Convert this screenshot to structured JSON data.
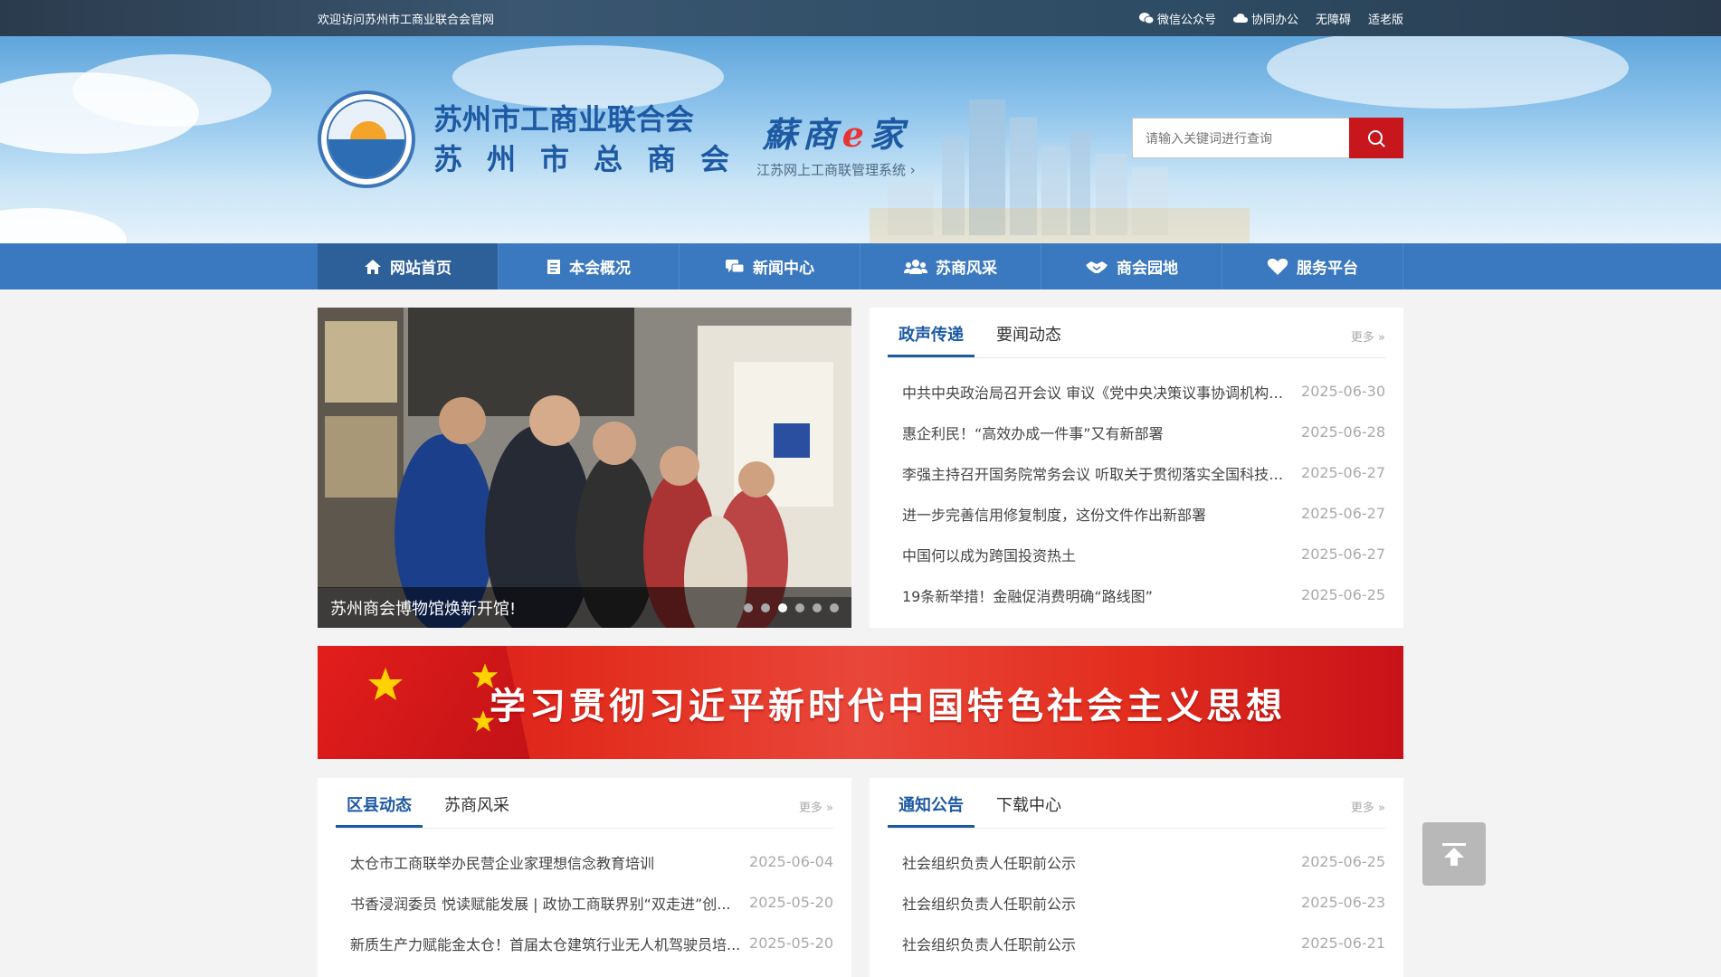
{
  "topbar": {
    "welcome": "欢迎访问苏州市工商业联合会官网",
    "links": [
      {
        "label": "微信公众号",
        "icon": "wechat-icon"
      },
      {
        "label": "协同办公",
        "icon": "cloud-icon"
      },
      {
        "label": "无障碍"
      },
      {
        "label": "适老版"
      }
    ]
  },
  "header": {
    "org_name_1": "苏州市工商业联合会",
    "org_name_2": "苏州市总商会",
    "esys_brand_1": "蘇商",
    "esys_brand_e": "e",
    "esys_brand_2": "家",
    "esys_sub": "江苏网上工商联管理系统",
    "search_placeholder": "请输入关键词进行查询"
  },
  "nav": {
    "items": [
      {
        "label": "网站首页",
        "icon": "home-icon",
        "active": true
      },
      {
        "label": "本会概况",
        "icon": "document-icon"
      },
      {
        "label": "新闻中心",
        "icon": "chat-icon"
      },
      {
        "label": "苏商风采",
        "icon": "people-icon"
      },
      {
        "label": "商会园地",
        "icon": "handshake-icon"
      },
      {
        "label": "服务平台",
        "icon": "heart-icon"
      }
    ]
  },
  "slider": {
    "caption": "苏州商会博物馆焕新开馆!",
    "dots": 6,
    "active_dot": 3
  },
  "news1": {
    "tabs": [
      "政声传递",
      "要闻动态"
    ],
    "more": "更多 »",
    "items": [
      {
        "title": "中共中央政治局召开会议 审议《党中央决策议事协调机构工...",
        "date": "2025-06-30"
      },
      {
        "title": "惠企利民！“高效办成一件事”又有新部署",
        "date": "2025-06-28"
      },
      {
        "title": "李强主持召开国务院常务会议 听取关于贯彻落实全国科技大...",
        "date": "2025-06-27"
      },
      {
        "title": "进一步完善信用修复制度，这份文件作出新部署",
        "date": "2025-06-27"
      },
      {
        "title": "中国何以成为跨国投资热土",
        "date": "2025-06-27"
      },
      {
        "title": "19条新举措！金融促消费明确“路线图”",
        "date": "2025-06-25"
      }
    ]
  },
  "banner": {
    "title": "学习贯彻习近平新时代中国特色社会主义思想"
  },
  "news2": {
    "tabs": [
      "区县动态",
      "苏商风采"
    ],
    "more": "更多 »",
    "items": [
      {
        "title": "太仓市工商联举办民营企业家理想信念教育培训",
        "date": "2025-06-04"
      },
      {
        "title": "书香浸润委员 悦读赋能发展 | 政协工商联界别“双走进”创...",
        "date": "2025-05-20"
      },
      {
        "title": "新质生产力赋能金太仓！首届太仓建筑行业无人机驾驶员培...",
        "date": "2025-05-20"
      }
    ]
  },
  "news3": {
    "tabs": [
      "通知公告",
      "下载中心"
    ],
    "more": "更多 »",
    "items": [
      {
        "title": "社会组织负责人任职前公示",
        "date": "2025-06-25"
      },
      {
        "title": "社会组织负责人任职前公示",
        "date": "2025-06-23"
      },
      {
        "title": "社会组织负责人任职前公示",
        "date": "2025-06-21"
      }
    ]
  },
  "colors": {
    "primary": "#1e5aa3",
    "nav": "#3a78bf",
    "nav_active": "#2d5f99",
    "search_button": "#c8161d",
    "banner": "#d7131a"
  }
}
